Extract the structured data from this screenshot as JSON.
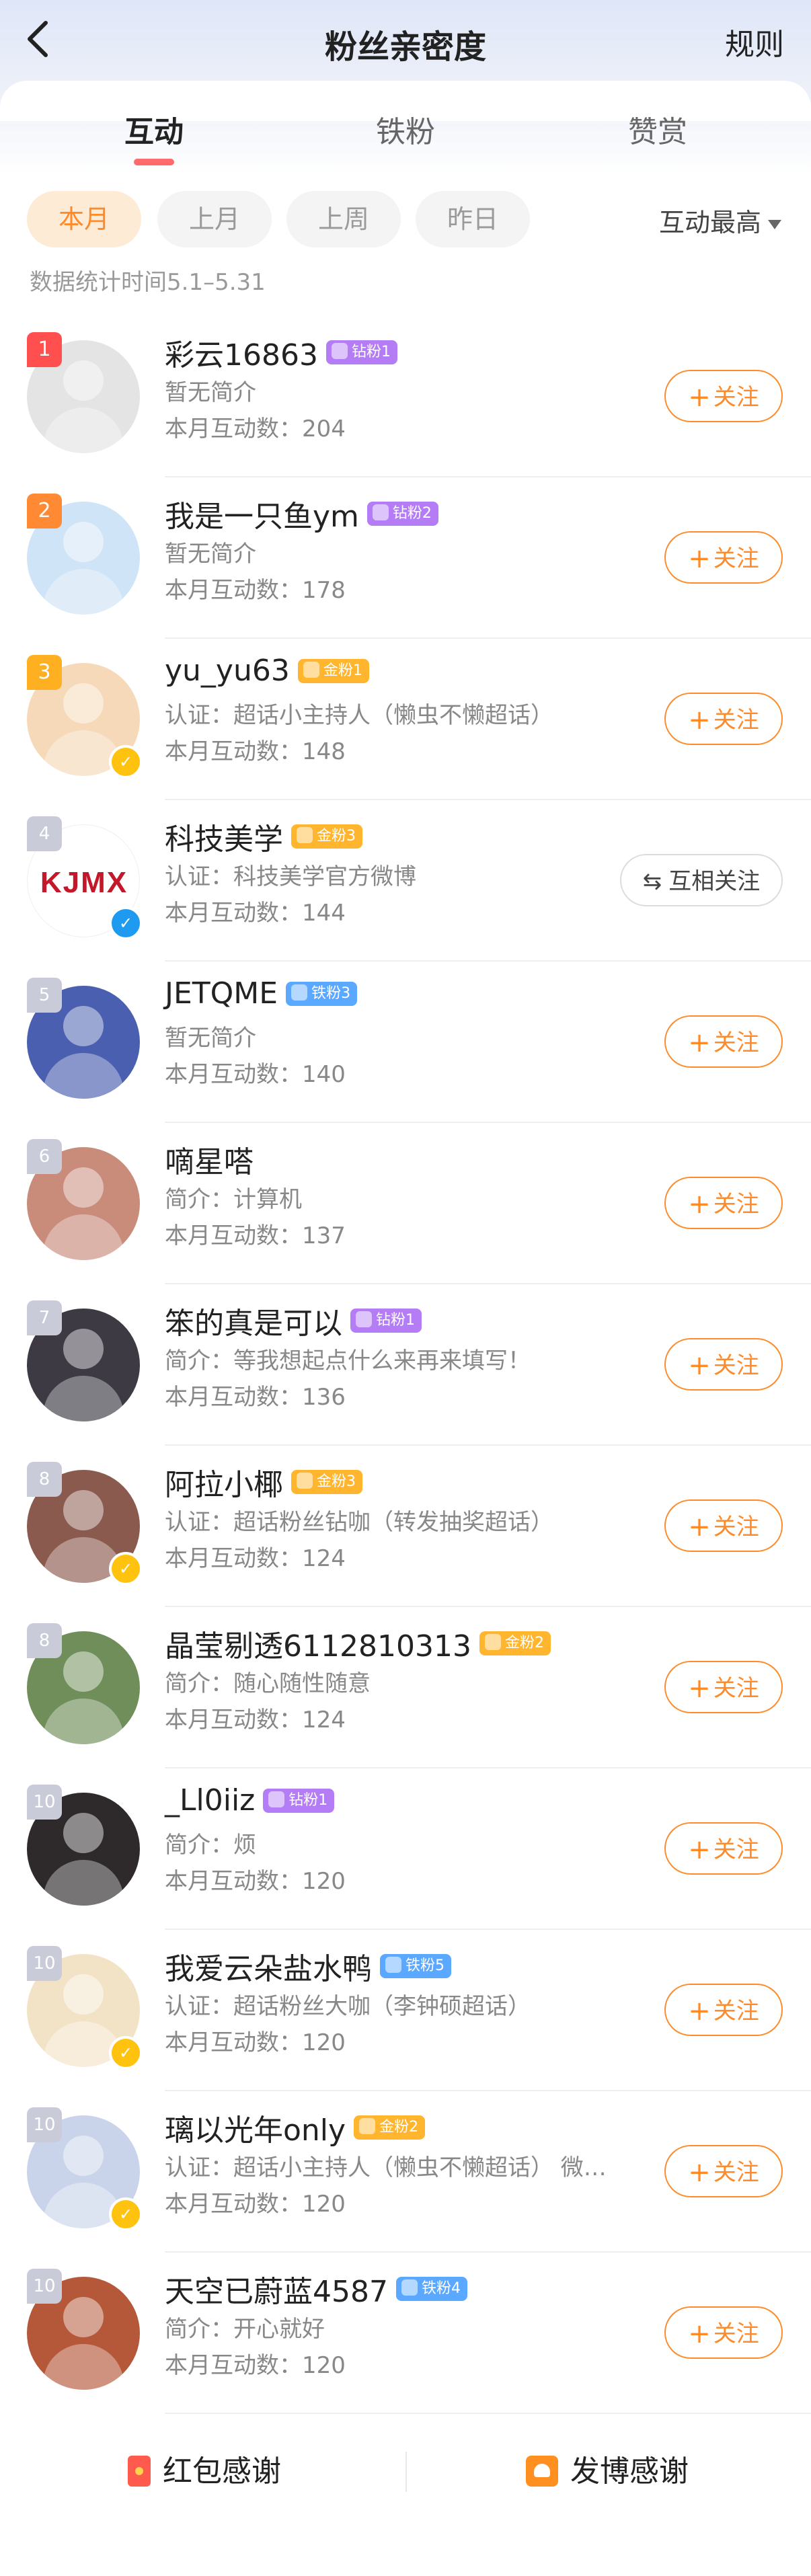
{
  "header": {
    "title": "粉丝亲密度",
    "rules": "规则"
  },
  "tabs": [
    {
      "label": "互动",
      "active": true
    },
    {
      "label": "铁粉",
      "active": false
    },
    {
      "label": "赞赏",
      "active": false
    }
  ],
  "filters": {
    "chips": [
      "本月",
      "上月",
      "上周",
      "昨日"
    ],
    "active": "本月",
    "sort": "互动最高"
  },
  "stats_time": "数据统计时间5.1–5.31",
  "fans": [
    {
      "rank": "1",
      "name": "彩云16863",
      "badge": "钻粉1",
      "badge_color": "#b47cf5",
      "desc": "暂无简介",
      "count": "本月互动数：204",
      "action": "关注",
      "avatar": "#e4e4e4",
      "verified": ""
    },
    {
      "rank": "2",
      "name": "我是一只鱼ym",
      "badge": "钻粉2",
      "badge_color": "#b47cf5",
      "desc": "暂无简介",
      "count": "本月互动数：178",
      "action": "关注",
      "avatar": "#cfe4f6",
      "verified": ""
    },
    {
      "rank": "3",
      "name": "yu_yu63",
      "badge": "金粉1",
      "badge_color": "#ffb62e",
      "desc": "认证：超话小主持人（懒虫不懒超话）",
      "count": "本月互动数：148",
      "action": "关注",
      "avatar": "#f6d9b8",
      "verified": "gold"
    },
    {
      "rank": "4",
      "name": "科技美学",
      "badge": "金粉3",
      "badge_color": "#ffb62e",
      "desc": "认证：科技美学官方微博",
      "count": "本月互动数：144",
      "action": "互相关注",
      "avatar": "#ffffff",
      "verified": "blue",
      "logo": "KJMX"
    },
    {
      "rank": "5",
      "name": "JETQME",
      "badge": "铁粉3",
      "badge_color": "#5aa8ff",
      "desc": "暂无简介",
      "count": "本月互动数：140",
      "action": "关注",
      "avatar": "#4a5fb0",
      "verified": ""
    },
    {
      "rank": "6",
      "name": "嘀星嗒",
      "badge": "",
      "badge_color": "",
      "desc": "简介：计算机",
      "count": "本月互动数：137",
      "action": "关注",
      "avatar": "#c98b7a",
      "verified": ""
    },
    {
      "rank": "7",
      "name": "笨的真是可以",
      "badge": "钻粉1",
      "badge_color": "#b47cf5",
      "desc": "简介：等我想起点什么来再来填写！",
      "count": "本月互动数：136",
      "action": "关注",
      "avatar": "#3d3a44",
      "verified": ""
    },
    {
      "rank": "8",
      "name": "阿拉小椰",
      "badge": "金粉3",
      "badge_color": "#ffb62e",
      "desc": "认证：超话粉丝钻咖（转发抽奖超话）",
      "count": "本月互动数：124",
      "action": "关注",
      "avatar": "#8a5a4e",
      "verified": "gold"
    },
    {
      "rank": "8",
      "name": "晶莹剔透6112810313",
      "badge": "金粉2",
      "badge_color": "#ffb62e",
      "desc": "简介：随心随性随意",
      "count": "本月互动数：124",
      "action": "关注",
      "avatar": "#6f8e5a",
      "verified": ""
    },
    {
      "rank": "10",
      "name": "_Ll0iiz",
      "badge": "钻粉1",
      "badge_color": "#b47cf5",
      "desc": "简介：烦",
      "count": "本月互动数：120",
      "action": "关注",
      "avatar": "#2e2a2c",
      "verified": ""
    },
    {
      "rank": "10",
      "name": "我爱云朵盐水鸭",
      "badge": "铁粉5",
      "badge_color": "#5aa8ff",
      "desc": "认证：超话粉丝大咖（李钟硕超话）",
      "count": "本月互动数：120",
      "action": "关注",
      "avatar": "#f3e3c6",
      "verified": "gold"
    },
    {
      "rank": "10",
      "name": "璃以光年only",
      "badge": "金粉2",
      "badge_color": "#ffb62e",
      "desc": "认证：超话小主持人（懒虫不懒超话） 微…",
      "count": "本月互动数：120",
      "action": "关注",
      "avatar": "#c9d4ea",
      "verified": "gold"
    },
    {
      "rank": "10",
      "name": "天空已蔚蓝4587",
      "badge": "铁粉4",
      "badge_color": "#5aa8ff",
      "desc": "简介：开心就好",
      "count": "本月互动数：120",
      "action": "关注",
      "avatar": "#b5583a",
      "verified": ""
    }
  ],
  "bottom": {
    "left": "红包感谢",
    "right": "发博感谢"
  }
}
